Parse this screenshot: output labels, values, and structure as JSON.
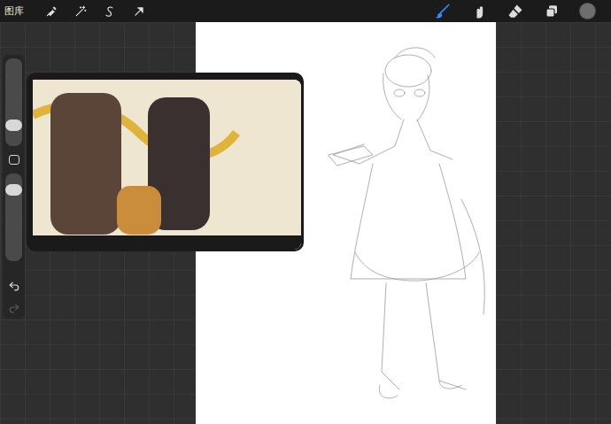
{
  "toolbar": {
    "gallery": "图库"
  },
  "tools": [
    {
      "kind": "brush",
      "selected": true
    },
    {
      "kind": "smudge",
      "selected": false
    },
    {
      "kind": "eraser",
      "selected": false
    }
  ],
  "color": {
    "color": "#6e6e6e"
  },
  "sidebar": {
    "sliders": [
      {
        "kind": "size",
        "level": 0.22
      },
      {
        "kind": "opacity",
        "level": 0.86
      }
    ],
    "undo": {
      "disabled": false
    },
    "redo": {
      "disabled": true
    }
  }
}
